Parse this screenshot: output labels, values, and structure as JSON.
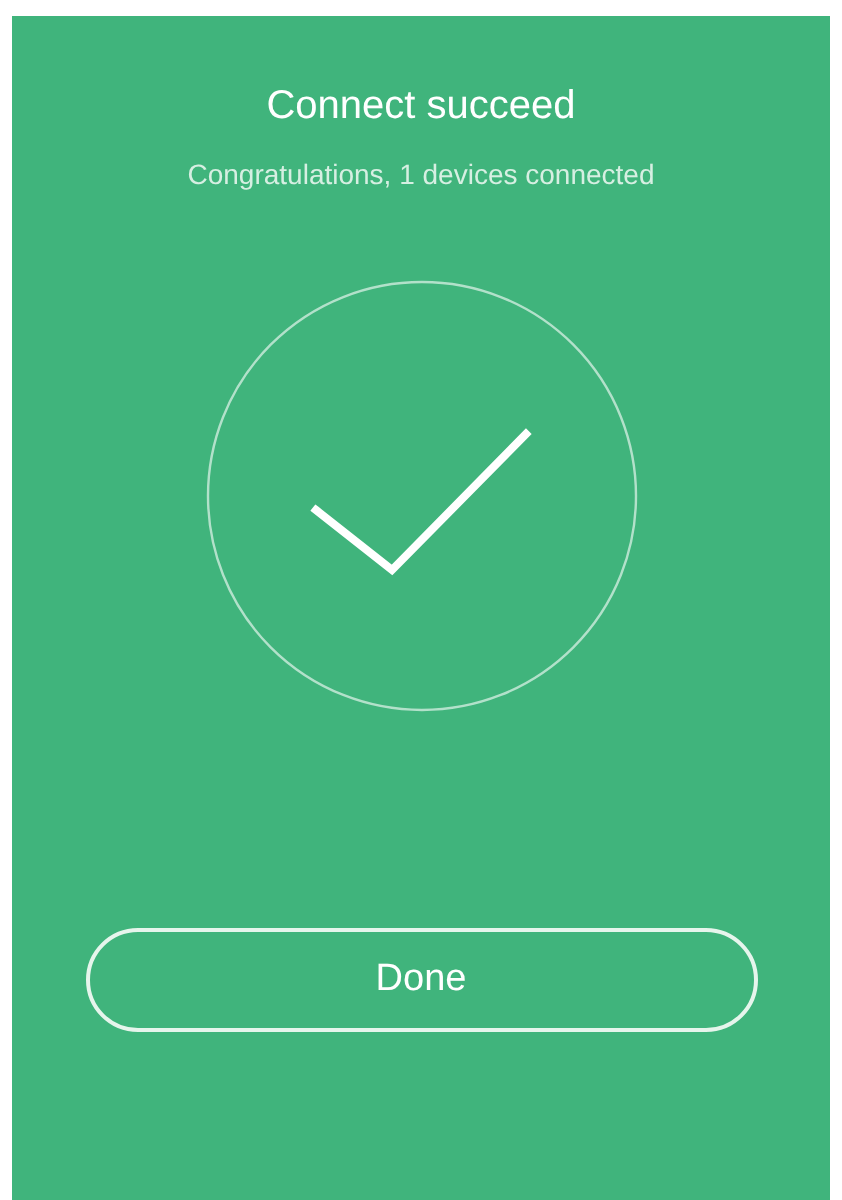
{
  "screen": {
    "title": "Connect succeed",
    "subtitle": "Congratulations, 1 devices connected"
  },
  "buttons": [
    {
      "label": "Done"
    }
  ]
}
